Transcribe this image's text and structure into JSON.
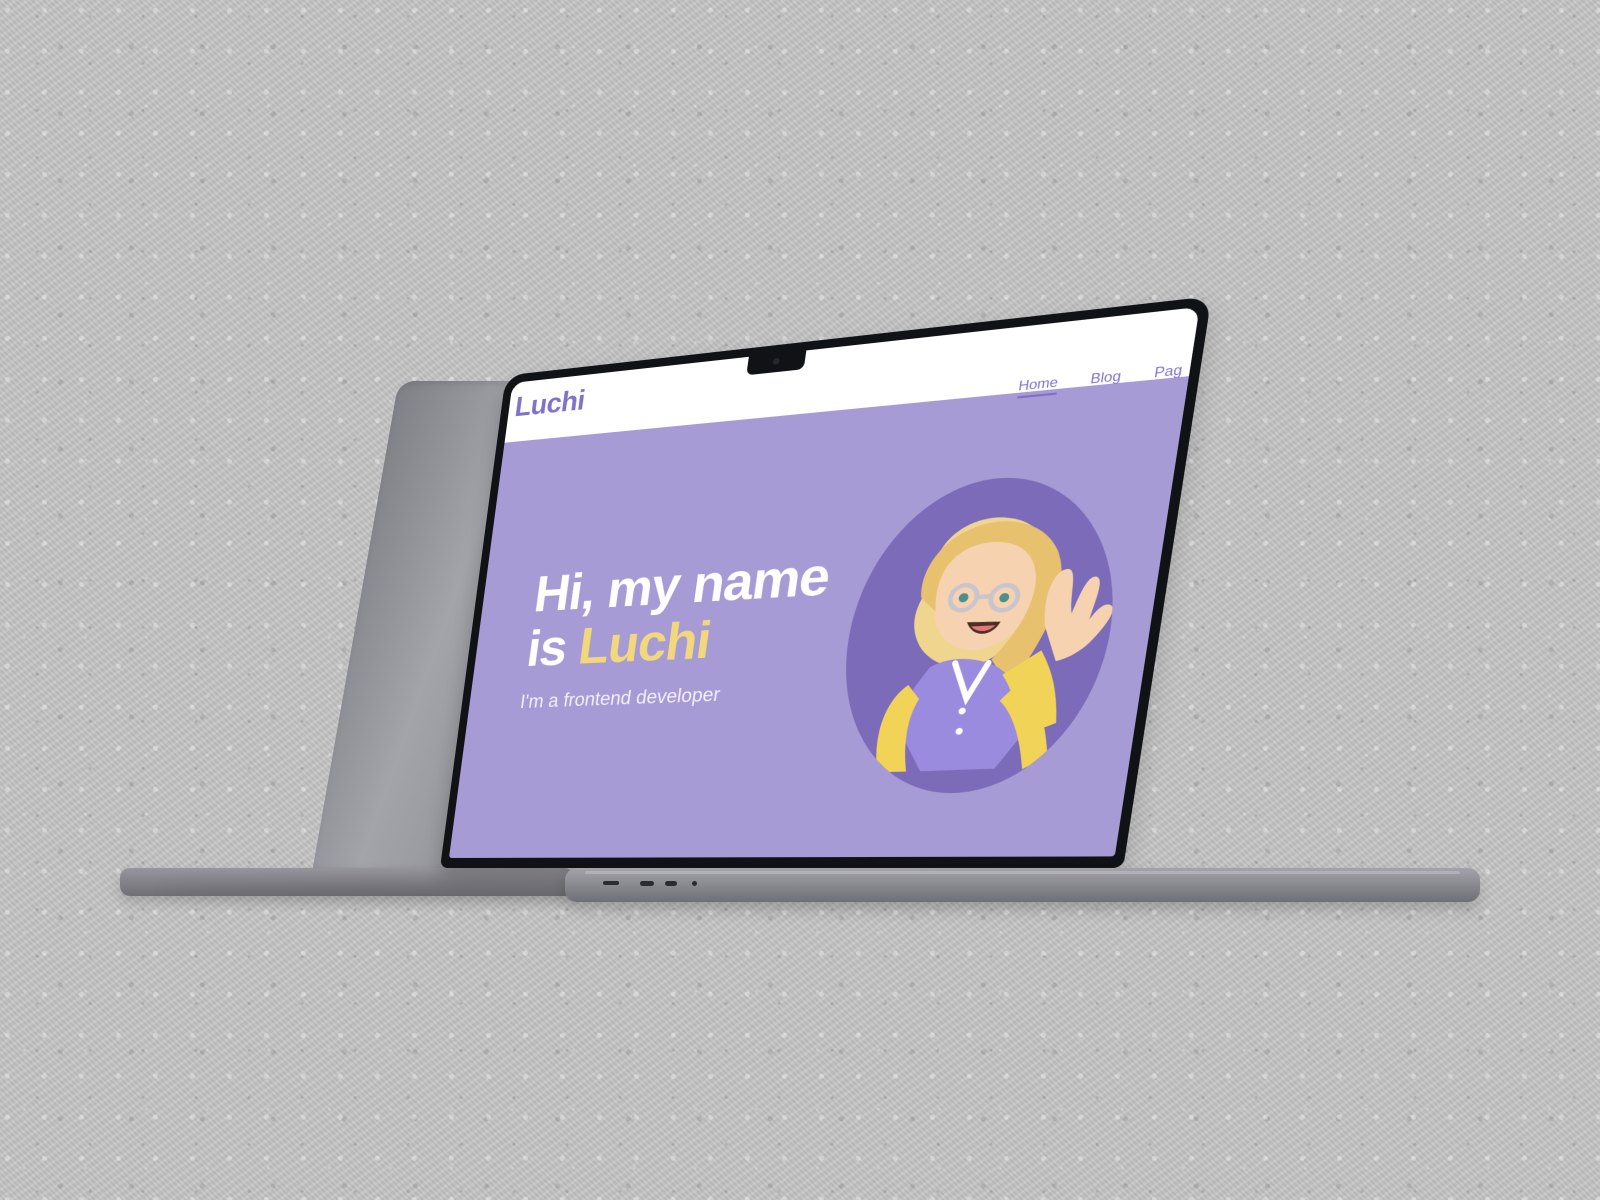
{
  "site": {
    "brand": "Luchi",
    "nav": [
      {
        "label": "Home",
        "active": true
      },
      {
        "label": "Blog",
        "active": false
      },
      {
        "label": "Pag",
        "active": false
      }
    ],
    "hero": {
      "title_part_1": "Hi, my name",
      "title_part_2": "is ",
      "name": "Luchi",
      "subtitle": "I'm a frontend developer"
    }
  },
  "colors": {
    "background": "#c3c3c3",
    "screen_purple": "#a79bd5",
    "avatar_circle": "#7b6bb8",
    "brand_purple": "#8172c8",
    "accent_yellow": "#f2d77c",
    "white": "#ffffff"
  },
  "icons": {
    "camera": "camera-icon"
  }
}
